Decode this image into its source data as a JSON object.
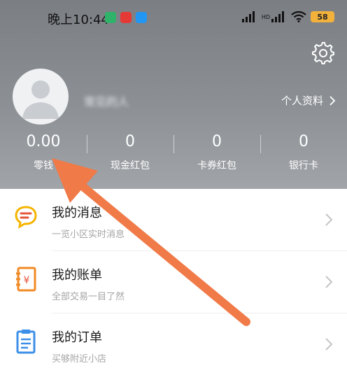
{
  "status_bar": {
    "time": "晚上10:44",
    "battery": "58",
    "hd_label": "HD"
  },
  "profile": {
    "username": "常见的人",
    "profile_link": "个人资料"
  },
  "stats": [
    {
      "value": "0.00",
      "label": "零钱"
    },
    {
      "value": "0",
      "label": "现金红包"
    },
    {
      "value": "0",
      "label": "卡券红包"
    },
    {
      "value": "0",
      "label": "银行卡"
    }
  ],
  "menu": [
    {
      "title": "我的消息",
      "subtitle": "一览小区实时消息",
      "icon": "message-icon",
      "color": "#f5b400"
    },
    {
      "title": "我的账单",
      "subtitle": "全部交易一目了然",
      "icon": "bill-icon",
      "color": "#f08a24"
    },
    {
      "title": "我的订单",
      "subtitle": "买够附近小店",
      "icon": "order-icon",
      "color": "#3c8fe8"
    }
  ],
  "colors": {
    "header_bg": "#868a8f",
    "annotation_arrow": "#f07a48"
  }
}
